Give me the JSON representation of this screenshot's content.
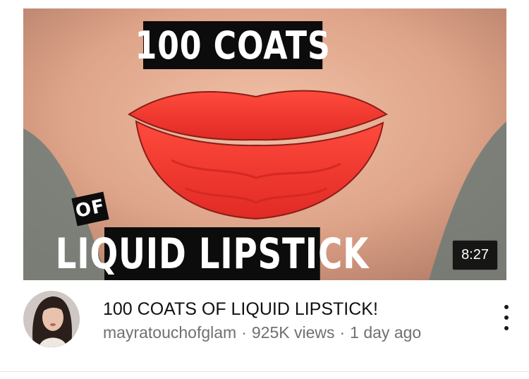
{
  "video": {
    "thumbnail": {
      "caption_top": "100 COATS",
      "caption_of": "OF",
      "caption_bottom": "LIQUID LIPSTICK",
      "duration": "8:27",
      "colors": {
        "skin": "#e2ab93",
        "lip": "#f2382f",
        "caption_bg": "#0c0c0c"
      }
    },
    "title": "100 COATS OF LIQUID LIPSTICK!",
    "channel": "mayratouchofglam",
    "separator": "·",
    "views": "925K views",
    "age": "1 day ago",
    "menu_icon": "more-vert-icon"
  }
}
